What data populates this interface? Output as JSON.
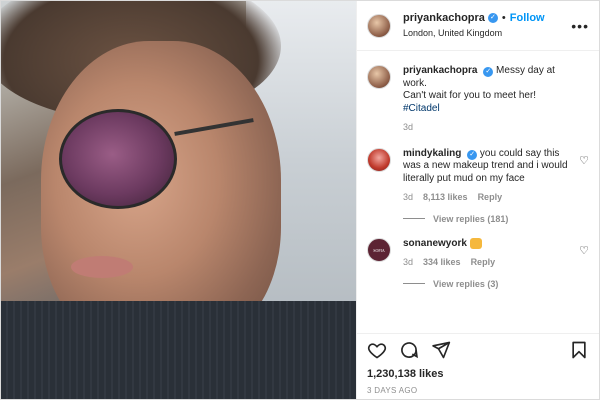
{
  "post": {
    "username": "priyankachopra",
    "follow_label": "Follow",
    "location": "London, United Kingdom",
    "caption": {
      "username": "priyankachopra",
      "text_line1": "Messy day at work.",
      "text_line2": "Can't wait for you to meet her!",
      "hashtag": "#Citadel",
      "age": "3d"
    },
    "likes": "1,230,138 likes",
    "timestamp": "3 DAYS AGO"
  },
  "comments": [
    {
      "username": "mindykaling",
      "text": "you could say this was a new makeup trend and i would literally put mud on my face",
      "age": "3d",
      "likes": "8,113 likes",
      "reply_label": "Reply",
      "view_replies": "View replies (181)"
    },
    {
      "username": "sonanewyork",
      "avatar_text": "SOFIA",
      "age": "3d",
      "likes": "334 likes",
      "reply_label": "Reply",
      "view_replies": "View replies (3)"
    }
  ],
  "icons": {
    "more": "more-options-icon",
    "heart": "heart-icon",
    "comment": "comment-icon",
    "share": "share-icon",
    "bookmark": "bookmark-icon",
    "verified": "verified-badge-icon"
  },
  "colors": {
    "accent": "#0095f6",
    "verified": "#3897f0",
    "hashtag": "#00376b",
    "muted": "#8e8e8e"
  }
}
